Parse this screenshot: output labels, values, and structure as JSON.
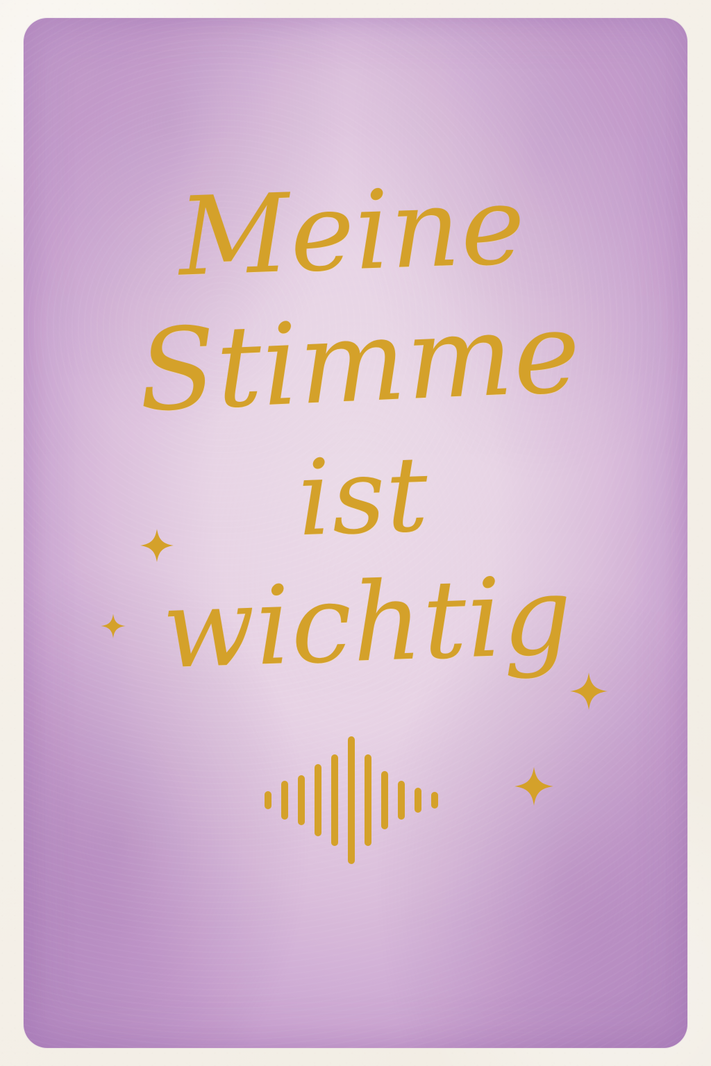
{
  "artwork": {
    "lines": [
      "Meine",
      "Stimme",
      "ist",
      "wichtig"
    ],
    "colors": {
      "accent": "#d4a12a",
      "background_purple": "#c7a1d0",
      "paper": "#f4f0e8"
    },
    "icons": {
      "sparkle": "sparkle-icon",
      "sound_wave": "sound-wave-icon"
    }
  }
}
